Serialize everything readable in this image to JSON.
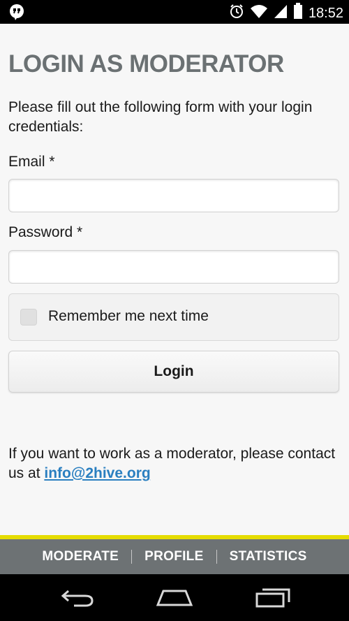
{
  "status_bar": {
    "time": "18:52",
    "icons": [
      "hangouts-icon",
      "alarm-icon",
      "wifi-icon",
      "signal-icon",
      "battery-icon"
    ]
  },
  "page": {
    "title": "LOGIN AS MODERATOR",
    "intro": "Please fill out the following form with your login credentials:"
  },
  "form": {
    "email_label": "Email *",
    "email_value": "",
    "password_label": "Password *",
    "password_value": "",
    "remember_label": "Remember me next time",
    "remember_checked": false,
    "login_button": "Login"
  },
  "contact": {
    "text": "If you want to work as a moderator, please contact us at ",
    "email": "info@2hive.org"
  },
  "footer_nav": {
    "items": [
      "MODERATE",
      "PROFILE",
      "STATISTICS"
    ]
  },
  "colors": {
    "title_gray": "#6b7173",
    "accent_yellow": "#e5dc00",
    "footer_gray": "#6d7274",
    "link_blue": "#2a7fc0"
  },
  "system_nav": {
    "buttons": [
      "back-icon",
      "home-icon",
      "recent-apps-icon"
    ]
  }
}
